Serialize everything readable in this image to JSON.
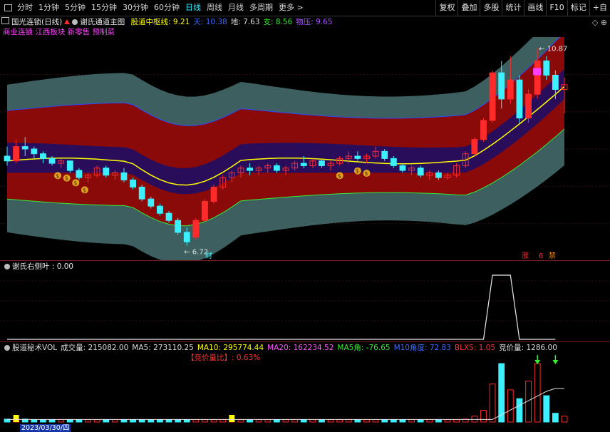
{
  "toolbar": {
    "periods": [
      "分时",
      "1分钟",
      "5分钟",
      "15分钟",
      "30分钟",
      "60分钟",
      "日线",
      "周线",
      "月线",
      "多周期",
      "更多 >"
    ],
    "active_period": "日线",
    "tools": [
      "复权",
      "叠加",
      "多股",
      "统计",
      "画线",
      "F10",
      "标记",
      "+自"
    ]
  },
  "main_panel": {
    "stock_name": "国光连锁(日线)",
    "indicator_name": "谢氏通道主图",
    "values": [
      {
        "label": "股道中枢线: 9.21",
        "color": "#ffff00"
      },
      {
        "label": "天: 10.38",
        "color": "#3a6bff"
      },
      {
        "label": "地: 7.63",
        "color": "#dddddd"
      },
      {
        "label": "支: 8.56",
        "color": "#33ee33"
      },
      {
        "label": "物压: 9.65",
        "color": "#aa55ff"
      }
    ],
    "tags": "商业连锁 江西板块 新零售 预制菜",
    "max_label": "10.87",
    "min_label": "6.72",
    "marker_cai": "财",
    "marker_zhang": "涨",
    "marker_six": "6",
    "marker_jie": "禁"
  },
  "osc_panel": {
    "title": "谢氏右侧叶 : 0.00"
  },
  "vol_panel": {
    "items": [
      {
        "label": "股道秘术VOL",
        "color": "#dddddd"
      },
      {
        "label": "成交量: 215082.00",
        "color": "#dddddd"
      },
      {
        "label": "MA5: 273110.25",
        "color": "#dddddd"
      },
      {
        "label": "MA10: 295774.44",
        "color": "#ffff00"
      },
      {
        "label": "MA20: 162234.52",
        "color": "#ff55ff"
      },
      {
        "label": "MA5角: -76.65",
        "color": "#33ee33"
      },
      {
        "label": "M10角度: 72.83",
        "color": "#3a6bff"
      },
      {
        "label": "BLXS: 1.05",
        "color": "#ff3333"
      },
      {
        "label": "竞价量: 1286.00",
        "color": "#dddddd"
      }
    ],
    "ratio": "【竞价量比】: 0.63%"
  },
  "date_label": "2023/03/30/四",
  "colors": {
    "up": "#ff2a2a",
    "down": "#3df0ff",
    "band_outer": "#3d5f5f",
    "band_mid": "#8a0a0a",
    "band_inner": "#2a0d5a",
    "center_line": "#ffff00"
  },
  "chart_data": {
    "type": "candlestick",
    "price_range": [
      6.4,
      11.1
    ],
    "candles": [
      {
        "o": 8.6,
        "h": 8.8,
        "l": 8.4,
        "c": 8.5
      },
      {
        "o": 8.5,
        "h": 8.95,
        "l": 8.45,
        "c": 8.8
      },
      {
        "o": 8.8,
        "h": 9.0,
        "l": 8.6,
        "c": 8.75
      },
      {
        "o": 8.75,
        "h": 8.8,
        "l": 8.55,
        "c": 8.65
      },
      {
        "o": 8.65,
        "h": 8.7,
        "l": 8.45,
        "c": 8.55
      },
      {
        "o": 8.55,
        "h": 8.6,
        "l": 8.4,
        "c": 8.45
      },
      {
        "o": 8.45,
        "h": 8.55,
        "l": 8.35,
        "c": 8.5
      },
      {
        "o": 8.5,
        "h": 8.5,
        "l": 8.25,
        "c": 8.3
      },
      {
        "o": 8.3,
        "h": 8.35,
        "l": 8.1,
        "c": 8.15
      },
      {
        "o": 8.15,
        "h": 8.25,
        "l": 8.05,
        "c": 8.2
      },
      {
        "o": 8.2,
        "h": 8.4,
        "l": 8.15,
        "c": 8.35
      },
      {
        "o": 8.35,
        "h": 8.4,
        "l": 8.15,
        "c": 8.2
      },
      {
        "o": 8.2,
        "h": 8.3,
        "l": 8.1,
        "c": 8.25
      },
      {
        "o": 8.25,
        "h": 8.35,
        "l": 8.05,
        "c": 8.1
      },
      {
        "o": 8.1,
        "h": 8.15,
        "l": 7.9,
        "c": 7.95
      },
      {
        "o": 7.95,
        "h": 8.0,
        "l": 7.65,
        "c": 7.7
      },
      {
        "o": 7.7,
        "h": 7.75,
        "l": 7.5,
        "c": 7.55
      },
      {
        "o": 7.55,
        "h": 7.6,
        "l": 7.35,
        "c": 7.4
      },
      {
        "o": 7.4,
        "h": 7.45,
        "l": 7.2,
        "c": 7.25
      },
      {
        "o": 7.25,
        "h": 7.3,
        "l": 6.95,
        "c": 7.0
      },
      {
        "o": 7.0,
        "h": 7.1,
        "l": 6.72,
        "c": 6.8
      },
      {
        "o": 6.9,
        "h": 7.3,
        "l": 6.85,
        "c": 7.25
      },
      {
        "o": 7.25,
        "h": 7.7,
        "l": 7.2,
        "c": 7.65
      },
      {
        "o": 7.65,
        "h": 8.0,
        "l": 7.6,
        "c": 7.95
      },
      {
        "o": 7.95,
        "h": 8.2,
        "l": 7.9,
        "c": 8.15
      },
      {
        "o": 8.15,
        "h": 8.3,
        "l": 8.05,
        "c": 8.25
      },
      {
        "o": 8.25,
        "h": 8.4,
        "l": 8.15,
        "c": 8.35
      },
      {
        "o": 8.35,
        "h": 8.45,
        "l": 8.2,
        "c": 8.3
      },
      {
        "o": 8.3,
        "h": 8.4,
        "l": 8.2,
        "c": 8.35
      },
      {
        "o": 8.35,
        "h": 8.45,
        "l": 8.25,
        "c": 8.4
      },
      {
        "o": 8.4,
        "h": 8.45,
        "l": 8.25,
        "c": 8.3
      },
      {
        "o": 8.3,
        "h": 8.4,
        "l": 8.2,
        "c": 8.35
      },
      {
        "o": 8.35,
        "h": 8.5,
        "l": 8.3,
        "c": 8.45
      },
      {
        "o": 8.45,
        "h": 8.6,
        "l": 8.35,
        "c": 8.4
      },
      {
        "o": 8.4,
        "h": 8.55,
        "l": 8.35,
        "c": 8.5
      },
      {
        "o": 8.5,
        "h": 8.55,
        "l": 8.35,
        "c": 8.4
      },
      {
        "o": 8.4,
        "h": 8.5,
        "l": 8.3,
        "c": 8.45
      },
      {
        "o": 8.45,
        "h": 8.6,
        "l": 8.4,
        "c": 8.55
      },
      {
        "o": 8.55,
        "h": 8.7,
        "l": 8.45,
        "c": 8.6
      },
      {
        "o": 8.6,
        "h": 8.7,
        "l": 8.5,
        "c": 8.55
      },
      {
        "o": 8.55,
        "h": 8.65,
        "l": 8.45,
        "c": 8.6
      },
      {
        "o": 8.6,
        "h": 8.8,
        "l": 8.55,
        "c": 8.7
      },
      {
        "o": 8.7,
        "h": 8.75,
        "l": 8.5,
        "c": 8.55
      },
      {
        "o": 8.55,
        "h": 8.6,
        "l": 8.35,
        "c": 8.4
      },
      {
        "o": 8.4,
        "h": 8.45,
        "l": 8.25,
        "c": 8.3
      },
      {
        "o": 8.3,
        "h": 8.4,
        "l": 8.2,
        "c": 8.35
      },
      {
        "o": 8.35,
        "h": 8.4,
        "l": 8.15,
        "c": 8.2
      },
      {
        "o": 8.2,
        "h": 8.3,
        "l": 8.1,
        "c": 8.25
      },
      {
        "o": 8.25,
        "h": 8.3,
        "l": 8.1,
        "c": 8.15
      },
      {
        "o": 8.15,
        "h": 8.25,
        "l": 8.1,
        "c": 8.2
      },
      {
        "o": 8.2,
        "h": 8.45,
        "l": 8.15,
        "c": 8.4
      },
      {
        "o": 8.4,
        "h": 8.7,
        "l": 8.35,
        "c": 8.65
      },
      {
        "o": 8.65,
        "h": 9.0,
        "l": 8.6,
        "c": 8.95
      },
      {
        "o": 8.95,
        "h": 9.4,
        "l": 8.9,
        "c": 9.35
      },
      {
        "o": 9.35,
        "h": 10.4,
        "l": 9.3,
        "c": 10.35
      },
      {
        "o": 10.35,
        "h": 10.6,
        "l": 9.6,
        "c": 9.8
      },
      {
        "o": 9.8,
        "h": 10.7,
        "l": 9.7,
        "c": 10.2
      },
      {
        "o": 10.2,
        "h": 10.3,
        "l": 9.3,
        "c": 9.4
      },
      {
        "o": 9.4,
        "h": 10.0,
        "l": 9.3,
        "c": 9.9
      },
      {
        "o": 9.9,
        "h": 10.87,
        "l": 9.8,
        "c": 10.6
      },
      {
        "o": 10.6,
        "h": 10.7,
        "l": 10.2,
        "c": 10.3
      },
      {
        "o": 10.3,
        "h": 10.4,
        "l": 9.8,
        "c": 10.0
      },
      {
        "o": 10.0,
        "h": 10.25,
        "l": 9.5,
        "c": 10.1
      }
    ],
    "osc": [
      0,
      0,
      0,
      0,
      0,
      0,
      0,
      0,
      0,
      0,
      0,
      0,
      0,
      0,
      0,
      0,
      0,
      0,
      0,
      0,
      0,
      0,
      0,
      0,
      0,
      0,
      0,
      0,
      0,
      0,
      0,
      0,
      0,
      0,
      0,
      0,
      0,
      0,
      0,
      0,
      0,
      0,
      0,
      0,
      0,
      0,
      0,
      0,
      0,
      0,
      0,
      0,
      0,
      0,
      1,
      1,
      1,
      0,
      0,
      0,
      0,
      0
    ],
    "volume": [
      0.05,
      0.05,
      0.05,
      0.04,
      0.04,
      0.04,
      0.04,
      0.04,
      0.04,
      0.04,
      0.04,
      0.04,
      0.04,
      0.04,
      0.04,
      0.04,
      0.04,
      0.04,
      0.04,
      0.04,
      0.04,
      0.04,
      0.04,
      0.04,
      0.04,
      0.04,
      0.04,
      0.04,
      0.04,
      0.04,
      0.04,
      0.04,
      0.04,
      0.04,
      0.04,
      0.04,
      0.04,
      0.04,
      0.04,
      0.04,
      0.04,
      0.04,
      0.04,
      0.04,
      0.04,
      0.04,
      0.04,
      0.04,
      0.04,
      0.04,
      0.04,
      0.05,
      0.1,
      0.2,
      0.65,
      1.0,
      0.55,
      0.4,
      0.7,
      1.0,
      0.45,
      0.15,
      0.1
    ]
  }
}
